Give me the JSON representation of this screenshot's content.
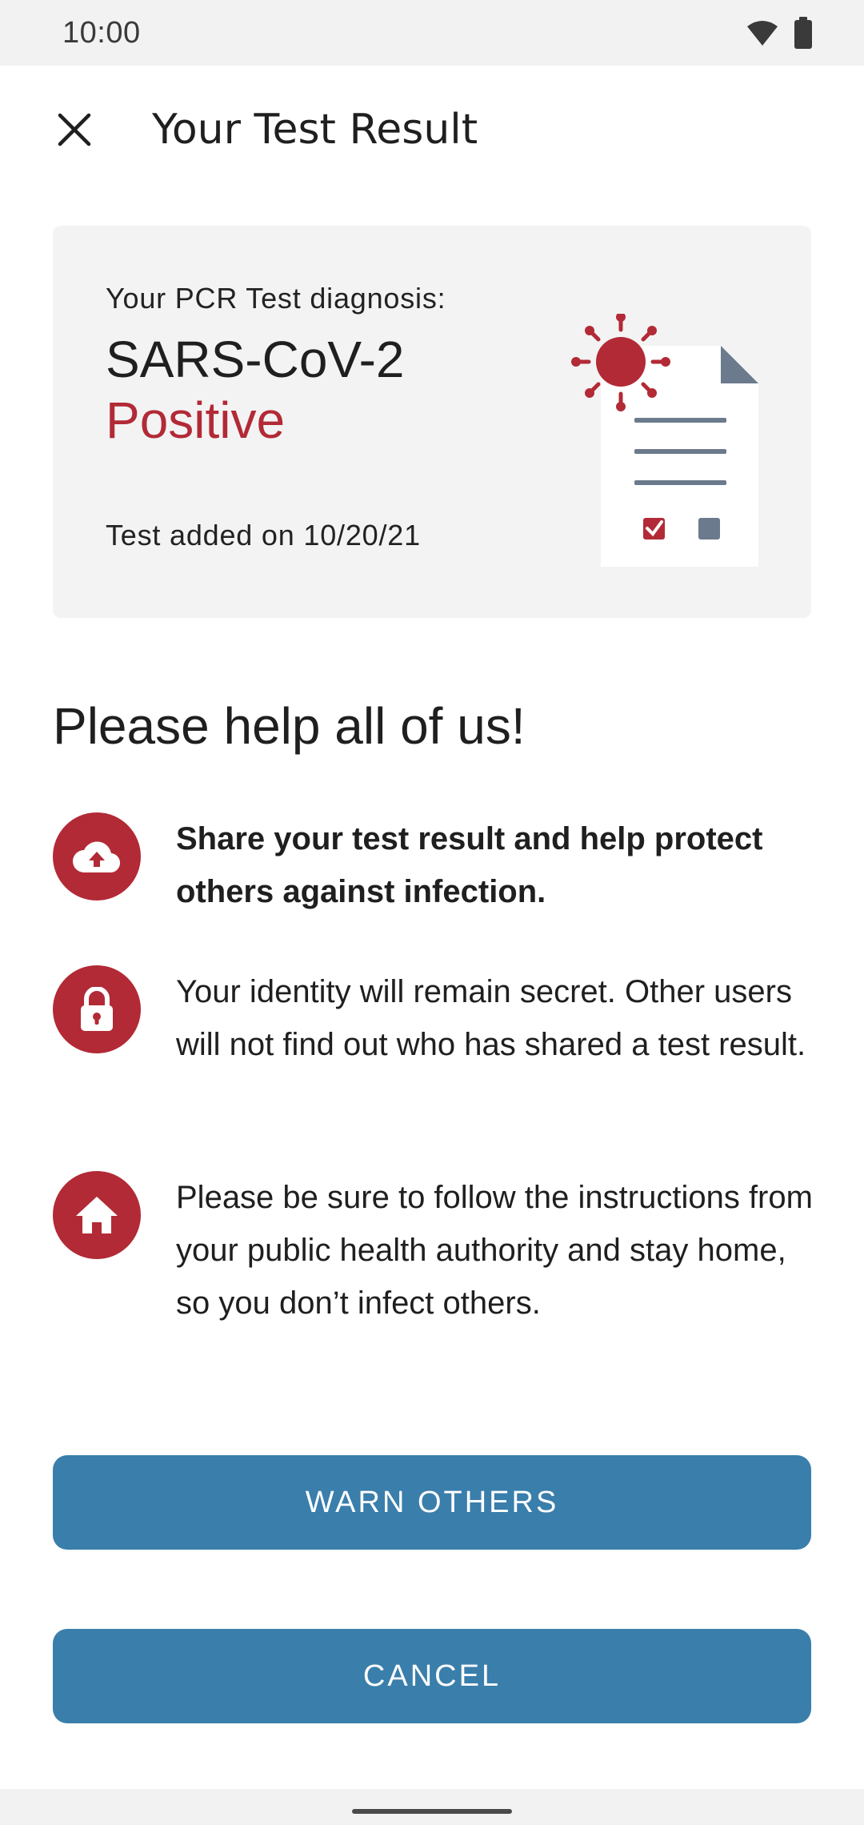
{
  "status_bar": {
    "time": "10:00",
    "icons": [
      "wifi-icon",
      "battery-icon"
    ]
  },
  "app_bar": {
    "close_icon": "close-icon",
    "title": "Your Test Result"
  },
  "result_card": {
    "label": "Your PCR Test diagnosis:",
    "virus": "SARS-CoV-2",
    "status": "Positive",
    "date": "Test added on 10/20/21",
    "illustration": "test-document-virus-illustration"
  },
  "help": {
    "title": "Please help all of us!",
    "items": [
      {
        "icon": "cloud-upload-icon",
        "text": "Share your test result and help protect others against infection."
      },
      {
        "icon": "lock-icon",
        "text": "Your identity will remain secret. Other users will not find out who has shared a test result."
      },
      {
        "icon": "home-icon",
        "text": "Please be sure to follow the instructions from your public health authority and stay home, so you don’t infect others."
      }
    ]
  },
  "buttons": {
    "warn": "WARN OTHERS",
    "cancel": "CANCEL"
  },
  "colors": {
    "accent_red": "#b22a36",
    "button_blue": "#3a7eab",
    "card_background": "#f3f3f3"
  }
}
